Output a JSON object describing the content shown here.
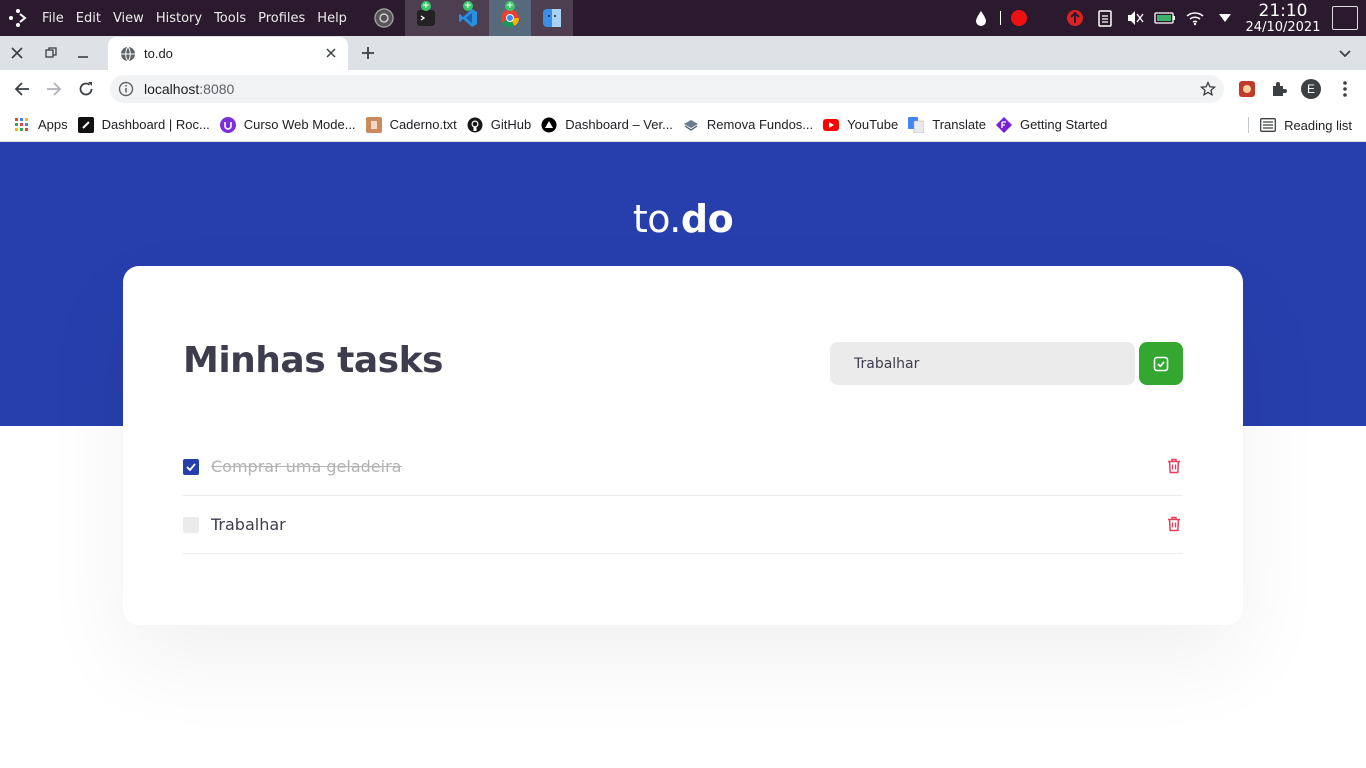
{
  "os_panel": {
    "menu": [
      "File",
      "Edit",
      "View",
      "History",
      "Tools",
      "Profiles",
      "Help"
    ],
    "clock_time": "21:10",
    "clock_date": "24/10/2021"
  },
  "browser": {
    "tab_title": "to.do",
    "url_host": "localhost",
    "url_port": ":8080",
    "profile_initial": "E",
    "bookmarks": [
      {
        "label": "Apps"
      },
      {
        "label": "Dashboard | Roc..."
      },
      {
        "label": "Curso Web Mode..."
      },
      {
        "label": "Caderno.txt"
      },
      {
        "label": "GitHub"
      },
      {
        "label": "Dashboard – Ver..."
      },
      {
        "label": "Remova Fundos..."
      },
      {
        "label": "YouTube"
      },
      {
        "label": "Translate"
      },
      {
        "label": "Getting Started"
      }
    ],
    "reading_list": "Reading list"
  },
  "app": {
    "logo_light": "to.",
    "logo_bold": "do",
    "title": "Minhas tasks",
    "input_value": "Trabalhar",
    "tasks": [
      {
        "text": "Comprar uma geladeira",
        "done": true
      },
      {
        "text": "Trabalhar",
        "done": false
      }
    ]
  },
  "colors": {
    "brand_blue": "#273fad",
    "add_green": "#33a72f",
    "delete_red": "#e83f5b"
  }
}
